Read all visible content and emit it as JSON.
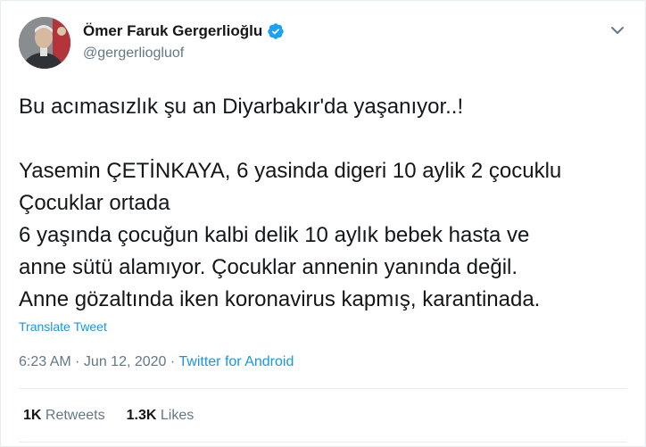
{
  "author": {
    "name": "Ömer Faruk Gergerlioğlu",
    "handle": "@gergerliogluof",
    "verified": true,
    "avatar_icon": "person-portrait"
  },
  "menu_icon": "chevron-down-icon",
  "tweet": {
    "lines_intro": [
      "Bu acımasızlık şu an Diyarbakır'da yaşanıyor..!"
    ],
    "lines_body": [
      "Yasemin ÇETİNKAYA, 6 yasinda digeri 10 aylik 2 çocuklu",
      "Çocuklar ortada",
      "6 yaşında çocuğun kalbi delik 10 aylık bebek hasta ve",
      "anne sütü alamıyor. Çocuklar annenin yanında değil.",
      "Anne gözaltında iken koronavirus kapmış, karantinada."
    ],
    "translate_label": "Translate Tweet"
  },
  "meta": {
    "time": "6:23 AM",
    "separator": " · ",
    "date": "Jun 12, 2020",
    "source": "Twitter for Android"
  },
  "stats": {
    "retweets_count": "1K",
    "retweets_label": "Retweets",
    "likes_count": "1.3K",
    "likes_label": "Likes"
  },
  "colors": {
    "text": "#14171a",
    "secondary": "#657786",
    "link": "#1b95e0",
    "divider": "#e6ecf0"
  }
}
